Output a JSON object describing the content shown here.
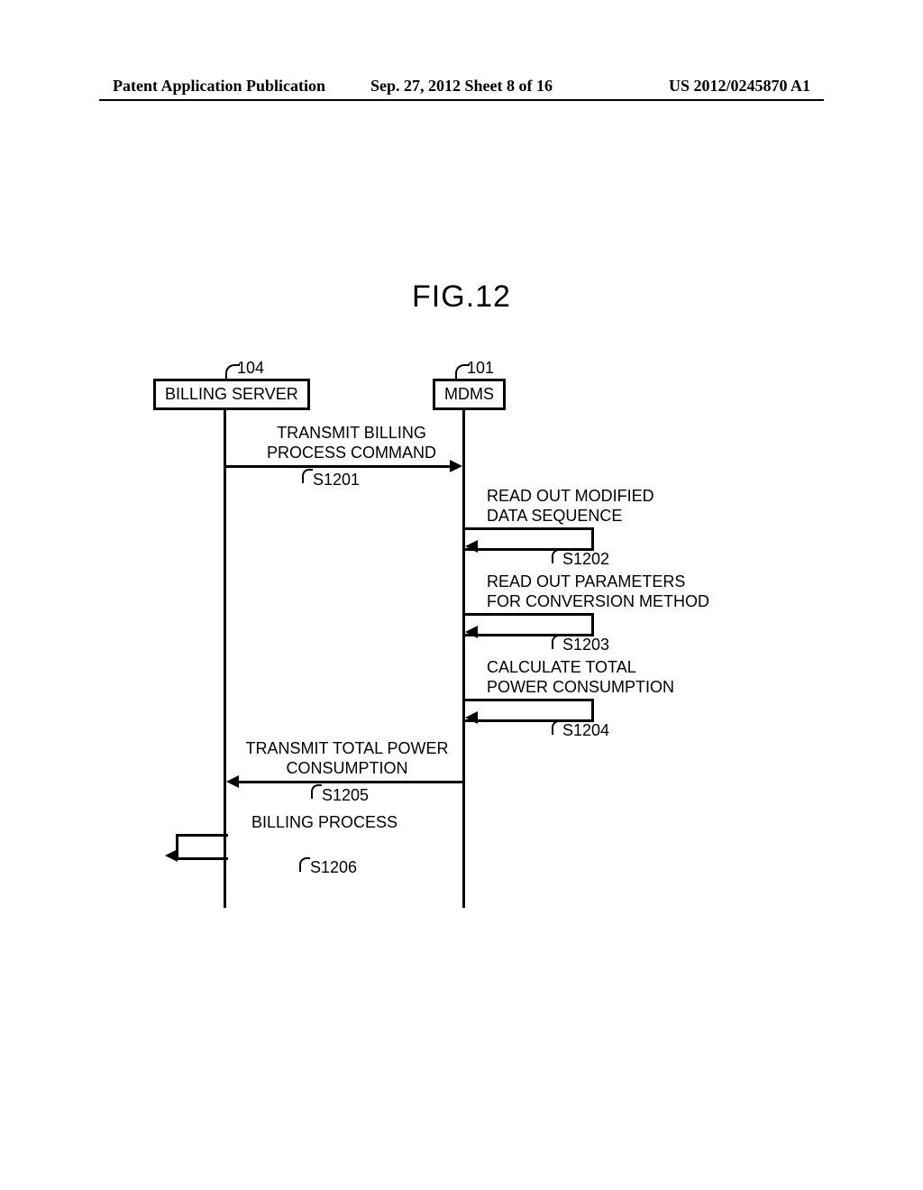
{
  "header": {
    "left": "Patent Application Publication",
    "center": "Sep. 27, 2012  Sheet 8 of 16",
    "right": "US 2012/0245870 A1"
  },
  "figure_title": "FIG.12",
  "actors": {
    "billing_server": {
      "ref": "104",
      "label": "BILLING SERVER"
    },
    "mdms": {
      "ref": "101",
      "label": "MDMS"
    }
  },
  "messages": {
    "s1201": {
      "text1": "TRANSMIT BILLING",
      "text2": "PROCESS COMMAND",
      "step": "S1201"
    },
    "s1202": {
      "text1": "READ OUT MODIFIED",
      "text2": "DATA SEQUENCE",
      "step": "S1202"
    },
    "s1203": {
      "text1": "READ OUT PARAMETERS",
      "text2": "FOR CONVERSION METHOD",
      "step": "S1203"
    },
    "s1204": {
      "text1": "CALCULATE TOTAL",
      "text2": "POWER CONSUMPTION",
      "step": "S1204"
    },
    "s1205": {
      "text1": "TRANSMIT TOTAL POWER",
      "text2": "CONSUMPTION",
      "step": "S1205"
    },
    "s1206": {
      "text1": "BILLING PROCESS",
      "step": "S1206"
    }
  }
}
